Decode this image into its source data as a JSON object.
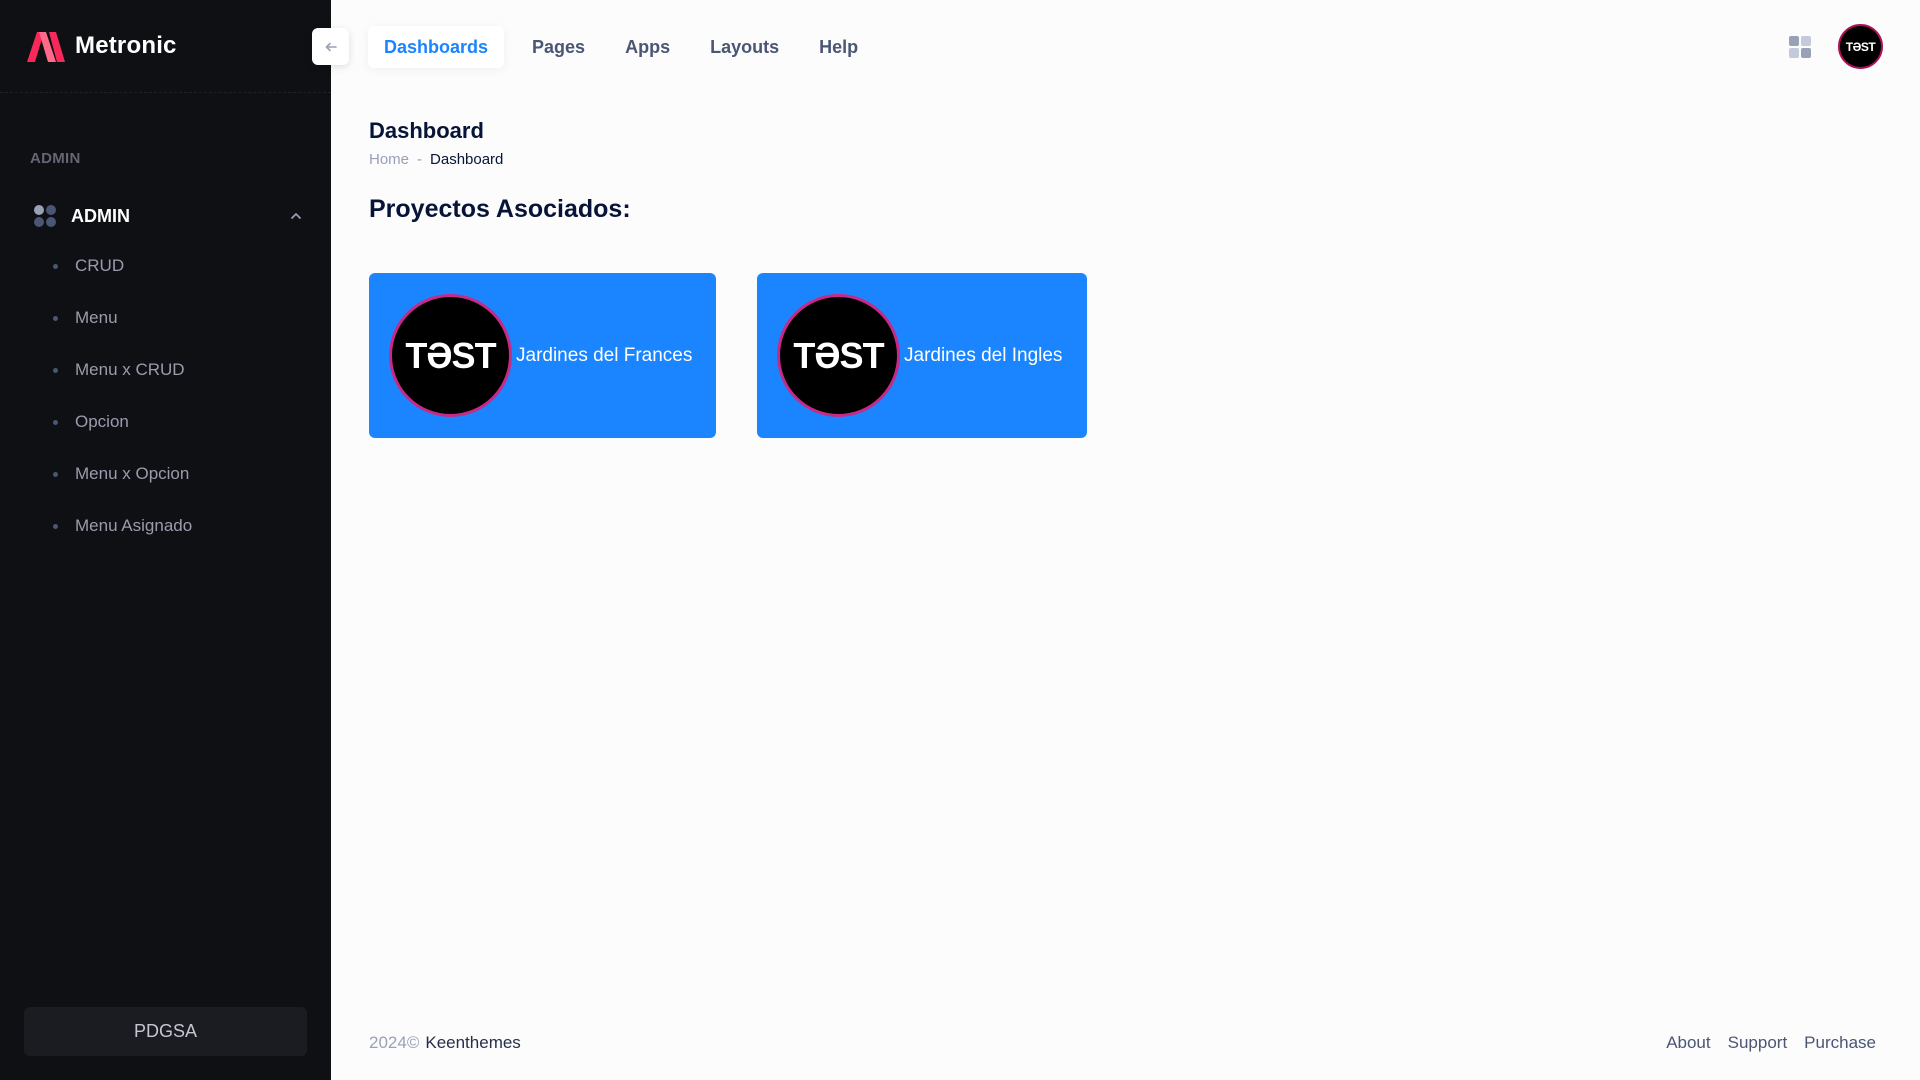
{
  "app": {
    "name": "Metronic"
  },
  "colors": {
    "sidebar_bg": "#0f1014",
    "accent": "#1b84ff",
    "logo_red": "#f8285a",
    "page_bg": "#fcfcfc"
  },
  "sidebar": {
    "section_label": "ADMIN",
    "group": {
      "label": "ADMIN",
      "icon": "apps-dots-icon",
      "expanded": true,
      "items": [
        {
          "label": "CRUD"
        },
        {
          "label": "Menu"
        },
        {
          "label": "Menu x CRUD"
        },
        {
          "label": "Opcion"
        },
        {
          "label": "Menu x Opcion"
        },
        {
          "label": "Menu Asignado"
        }
      ]
    },
    "footer_button": "PDGSA"
  },
  "header": {
    "nav": [
      {
        "label": "Dashboards",
        "active": true
      },
      {
        "label": "Pages"
      },
      {
        "label": "Apps"
      },
      {
        "label": "Layouts"
      },
      {
        "label": "Help"
      }
    ],
    "avatar_text": "TƏST"
  },
  "page": {
    "title": "Dashboard",
    "breadcrumb": {
      "home": "Home",
      "separator": "-",
      "current": "Dashboard"
    },
    "section_heading": "Proyectos Asociados:",
    "projects": [
      {
        "logo_text": "TƏST",
        "name": "Jardines del Frances"
      },
      {
        "logo_text": "TƏST",
        "name": "Jardines del Ingles"
      }
    ]
  },
  "footer": {
    "year": "2024©",
    "brand": "Keenthemes",
    "links": [
      "About",
      "Support",
      "Purchase"
    ]
  }
}
